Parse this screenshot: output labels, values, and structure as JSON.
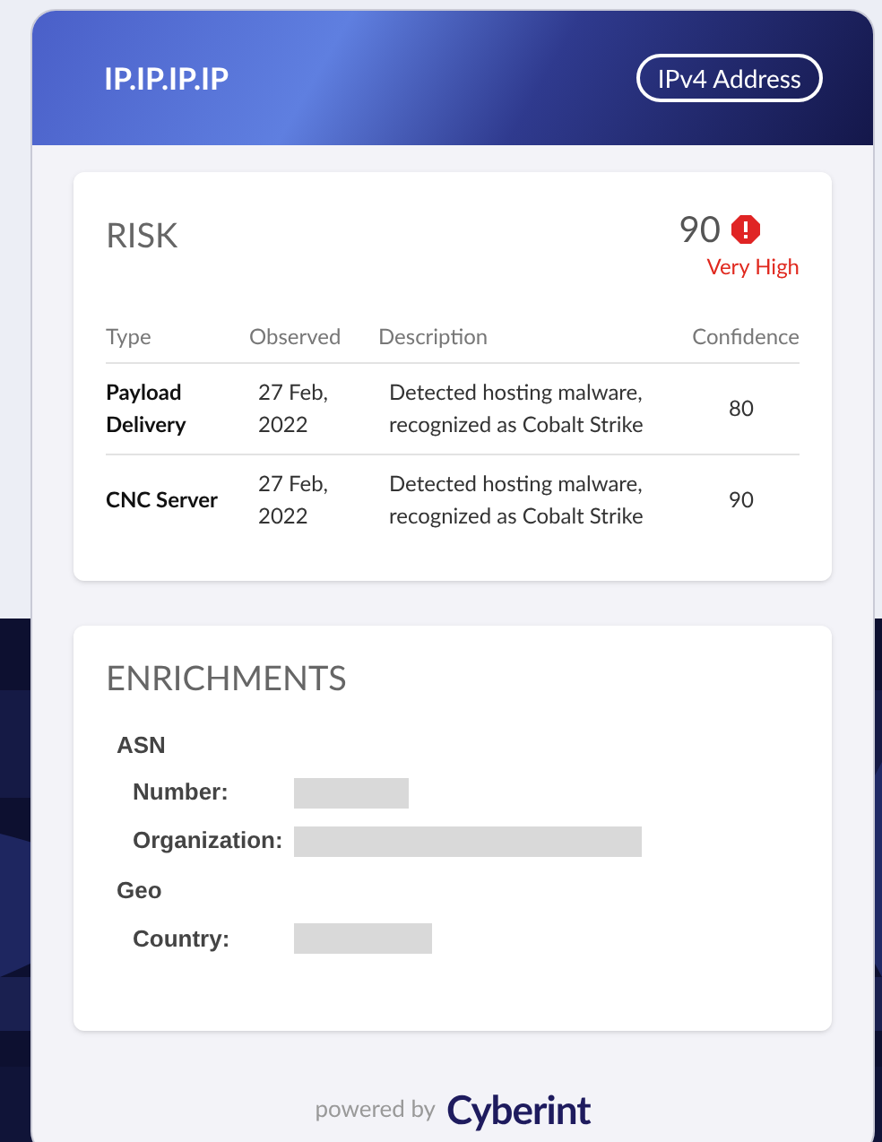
{
  "header": {
    "title": "IP.IP.IP.IP",
    "badge": "IPv4 Address"
  },
  "risk": {
    "title": "RISK",
    "score": "90",
    "level_label": "Very High",
    "columns": [
      "Type",
      "Observed",
      "Description",
      "Confidence"
    ],
    "rows": [
      {
        "type": "Payload Delivery",
        "observed": "27 Feb, 2022",
        "description": "Detected hosting malware, recognized as Cobalt Strike",
        "confidence": "80"
      },
      {
        "type": "CNC Server",
        "observed": "27 Feb, 2022",
        "description": "Detected hosting malware, recognized as Cobalt Strike",
        "confidence": "90"
      }
    ]
  },
  "enrichments": {
    "title": "ENRICHMENTS",
    "groups": [
      {
        "label": "ASN",
        "fields": [
          {
            "label": "Number:",
            "redacted": true
          },
          {
            "label": "Organization:",
            "redacted": true
          }
        ]
      },
      {
        "label": "Geo",
        "fields": [
          {
            "label": "Country:",
            "redacted": true
          }
        ]
      }
    ]
  },
  "footer": {
    "powered_by": "powered by",
    "brand": "Cyberint"
  }
}
